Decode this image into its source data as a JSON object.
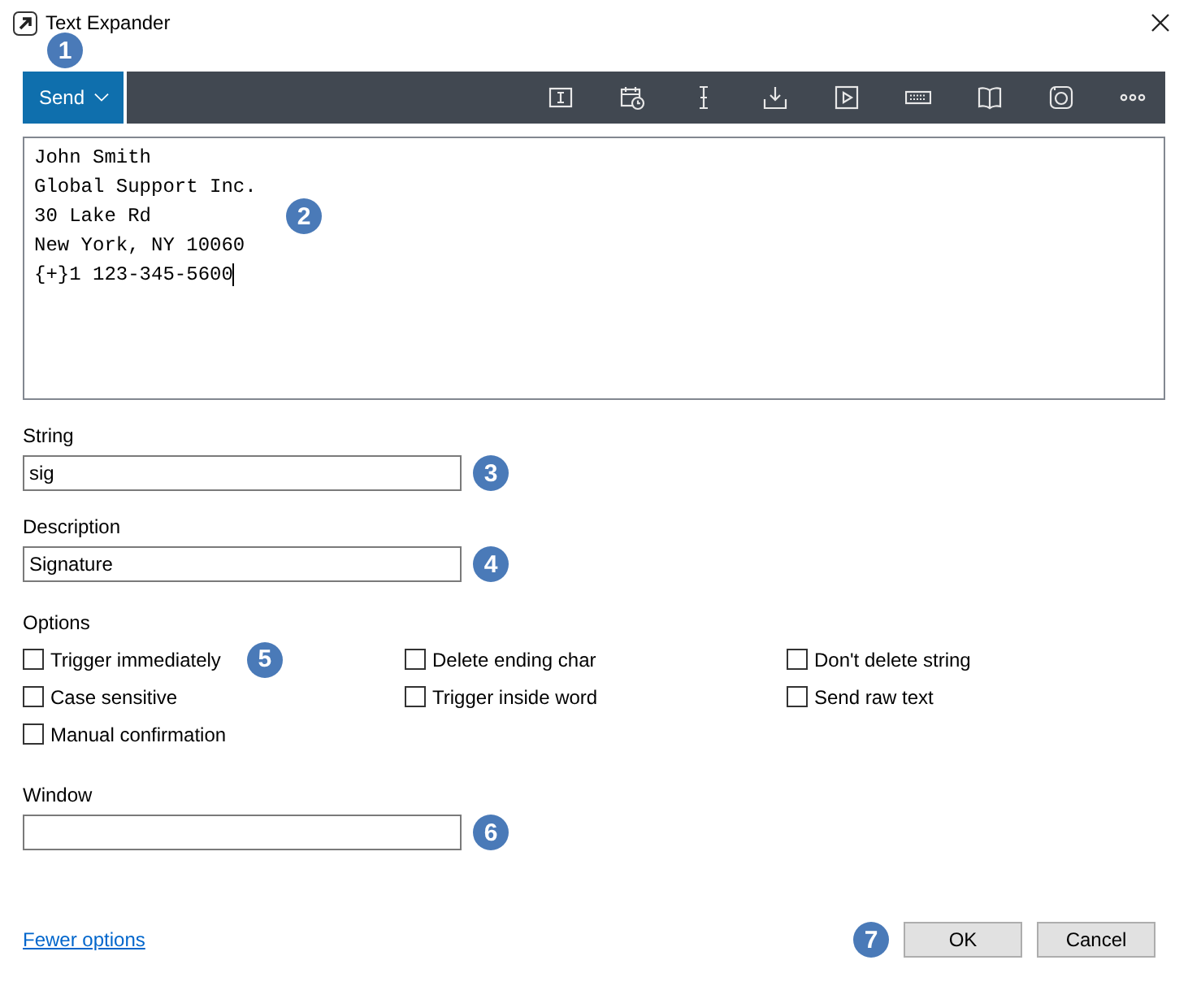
{
  "window": {
    "title": "Text Expander"
  },
  "toolbar": {
    "send_label": "Send",
    "callout": "1"
  },
  "editor": {
    "lines": [
      "John Smith",
      "Global Support Inc.",
      "30 Lake Rd",
      "New York, NY 10060",
      "{+}1 123-345-5600"
    ],
    "callout": "2"
  },
  "fields": [
    {
      "label": "String",
      "value": "sig",
      "callout": "3"
    },
    {
      "label": "Description",
      "value": "Signature",
      "callout": "4"
    }
  ],
  "options": {
    "label": "Options",
    "callout": "5",
    "checkboxes": [
      {
        "label": "Trigger immediately",
        "checked": false
      },
      {
        "label": "Delete ending char",
        "checked": false
      },
      {
        "label": "Don't delete string",
        "checked": false
      },
      {
        "label": "Case sensitive",
        "checked": false
      },
      {
        "label": "Trigger inside word",
        "checked": false
      },
      {
        "label": "Send raw text",
        "checked": false
      },
      {
        "label": "Manual confirmation",
        "checked": false
      }
    ]
  },
  "window_field": {
    "label": "Window",
    "callout": "6"
  },
  "footer": {
    "link": "Fewer options",
    "callout": "7",
    "buttons": [
      "OK",
      "Cancel"
    ]
  }
}
